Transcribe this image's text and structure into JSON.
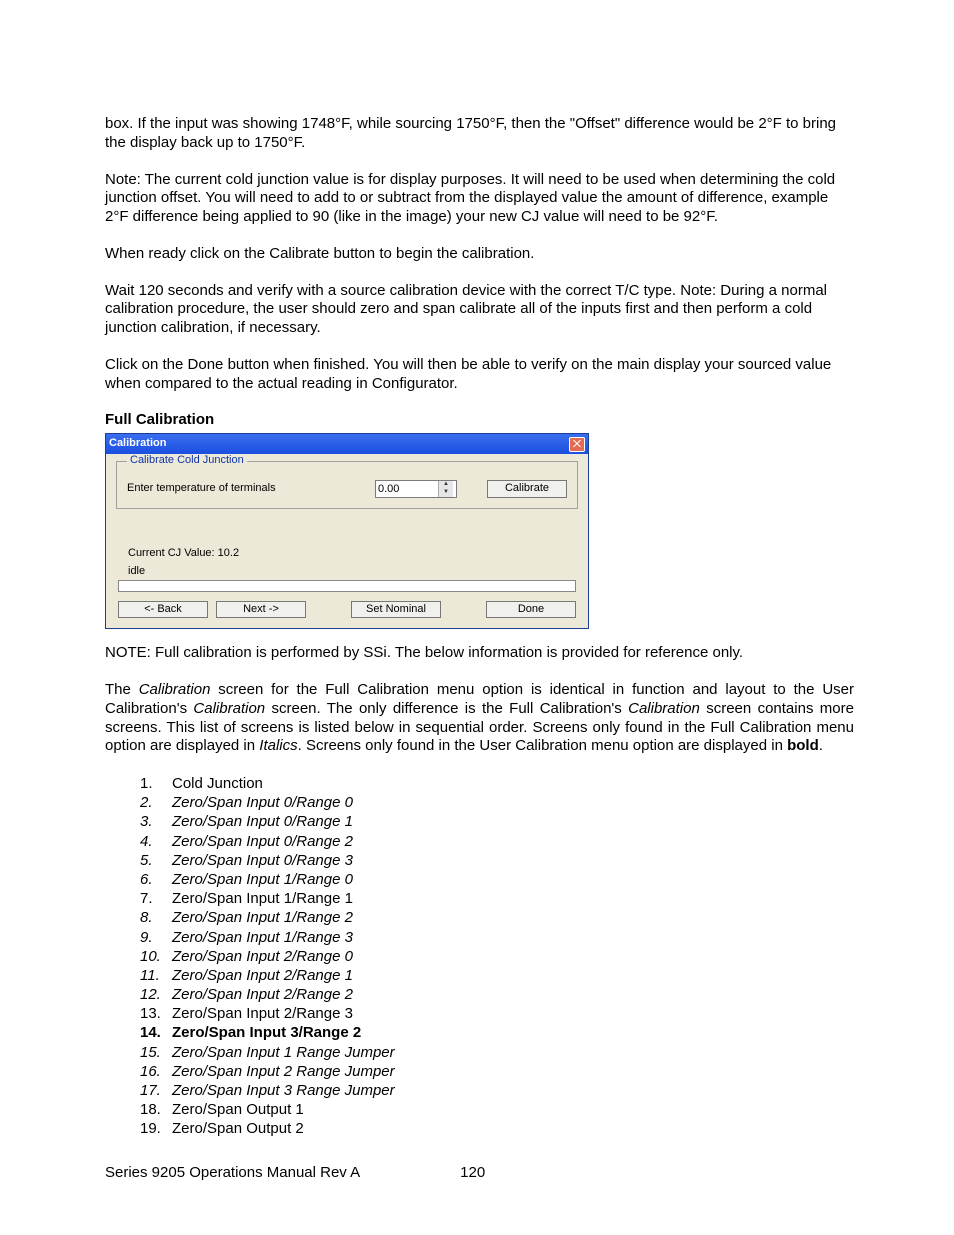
{
  "paragraphs": {
    "p1": "box. If the input was showing 1748°F, while sourcing 1750°F, then the \"Offset\" difference would be 2°F to bring the display back up to 1750°F.",
    "p2": "Note: The current cold junction value is for display purposes. It will need to be used when determining the cold junction offset. You will need to add to or subtract from the displayed value the amount of difference, example 2°F difference being applied to 90 (like in the image) your new CJ value will need to be 92°F.",
    "p3": "When ready click on the Calibrate button to begin the calibration.",
    "p4": "Wait 120 seconds and verify with a source calibration device with the correct T/C type. Note: During a normal calibration procedure, the user should zero and span calibrate all of the inputs first and then perform a cold junction calibration, if necessary.",
    "p5": "Click on the Done button when finished. You will then be able to verify on the main display your sourced value when compared to the actual reading in Configurator.",
    "note2": "NOTE: Full calibration is performed by SSi. The below information is provided for reference only."
  },
  "section_title": "Full Calibration",
  "dialog": {
    "title": "Calibration",
    "group_title": "Calibrate Cold Junction",
    "enter_temp_label": "Enter temperature of terminals",
    "temp_value": "0.00",
    "calibrate_btn": "Calibrate",
    "cj_label": "Current CJ Value: 10.2",
    "idle_label": "idle",
    "back_btn": "<- Back",
    "next_btn": "Next ->",
    "set_nominal_btn": "Set Nominal",
    "done_btn": "Done"
  },
  "desc": {
    "t1": "The ",
    "t2": "Calibration",
    "t3": " screen for the Full Calibration menu option is identical in function and layout to the User Calibration's ",
    "t4": "Calibration",
    "t5": " screen.  The only difference is the Full Calibration's ",
    "t6": "Calibration",
    "t7": " screen contains more screens.  This list of screens is listed below in sequential order.  Screens only found in the Full Calibration menu option are displayed in ",
    "t8": "Italics",
    "t9": ".  Screens only found in the User Calibration menu option are displayed in ",
    "t10": "bold",
    "t11": "."
  },
  "list": [
    {
      "num": "1.",
      "text": "Cold Junction",
      "style": "normal"
    },
    {
      "num": "2.",
      "text": "Zero/Span Input 0/Range 0",
      "style": "italic"
    },
    {
      "num": "3.",
      "text": "Zero/Span Input 0/Range 1",
      "style": "italic"
    },
    {
      "num": "4.",
      "text": "Zero/Span Input 0/Range 2",
      "style": "italic"
    },
    {
      "num": "5.",
      "text": "Zero/Span Input 0/Range 3",
      "style": "italic"
    },
    {
      "num": "6.",
      "text": "Zero/Span Input 1/Range 0",
      "style": "italic"
    },
    {
      "num": "7.",
      "text": "Zero/Span Input 1/Range 1",
      "style": "normal"
    },
    {
      "num": "8.",
      "text": "Zero/Span Input 1/Range 2",
      "style": "italic"
    },
    {
      "num": "9.",
      "text": "Zero/Span Input 1/Range 3",
      "style": "italic"
    },
    {
      "num": "10.",
      "text": "Zero/Span Input 2/Range 0",
      "style": "italic"
    },
    {
      "num": "11.",
      "text": "Zero/Span Input 2/Range 1",
      "style": "italic"
    },
    {
      "num": "12.",
      "text": "Zero/Span Input 2/Range 2",
      "style": "italic"
    },
    {
      "num": "13.",
      "text": "Zero/Span Input 2/Range 3",
      "style": "normal"
    },
    {
      "num": "14.",
      "text": "Zero/Span Input 3/Range 2",
      "style": "bold"
    },
    {
      "num": "15.",
      "text": "Zero/Span Input 1 Range Jumper",
      "style": "italic"
    },
    {
      "num": "16.",
      "text": "Zero/Span Input 2 Range Jumper",
      "style": "italic"
    },
    {
      "num": "17.",
      "text": "Zero/Span Input 3 Range Jumper",
      "style": "italic"
    },
    {
      "num": "18.",
      "text": "Zero/Span Output 1",
      "style": "normal"
    },
    {
      "num": "19.",
      "text": "Zero/Span Output 2",
      "style": "normal"
    }
  ],
  "footer": {
    "left": "Series 9205 Operations Manual Rev A",
    "page": "120"
  }
}
